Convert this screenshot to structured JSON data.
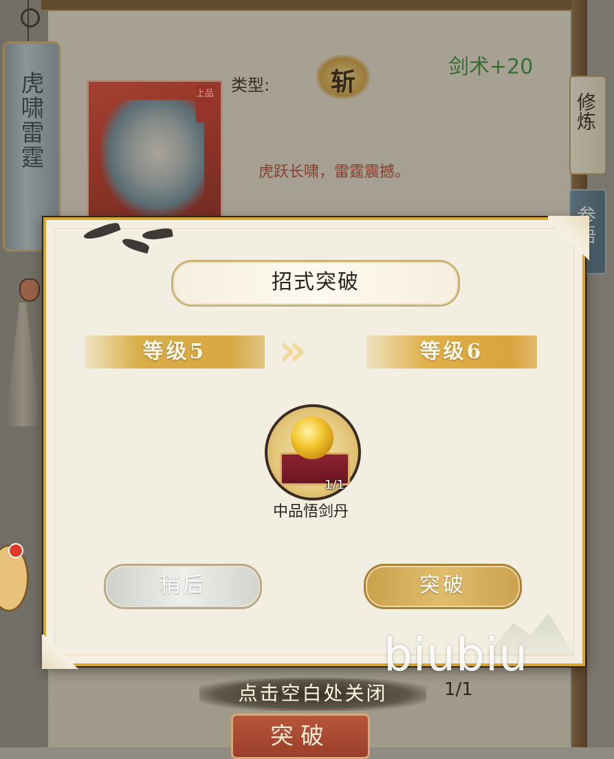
{
  "skill": {
    "banner_title": "虎啸雷霆",
    "card_grade": "上品",
    "type_label": "类型:",
    "type_value": "斩",
    "stat": "剑术+20",
    "description": "虎跃长啸，雷霆震撼。"
  },
  "side_tabs": {
    "cultivate": "修炼",
    "comprehend": "参悟"
  },
  "modal": {
    "title": "招式突破",
    "level_from": "等级5",
    "level_to": "等级6",
    "arrows": "»",
    "item": {
      "count": "1/1",
      "name": "中品悟剑丹",
      "icon": "golden-orb-icon"
    },
    "later_button": "稍后",
    "break_button": "突破"
  },
  "footer": {
    "close_hint": "点击空白处关闭",
    "count": "1/1",
    "breakthrough_button": "突破"
  },
  "watermark": "biubiu",
  "colors": {
    "modal_border": "#d9a630",
    "level_gold": "#d9ae49",
    "stat_green": "#3f8a3a",
    "desc_red": "#a84a35"
  }
}
